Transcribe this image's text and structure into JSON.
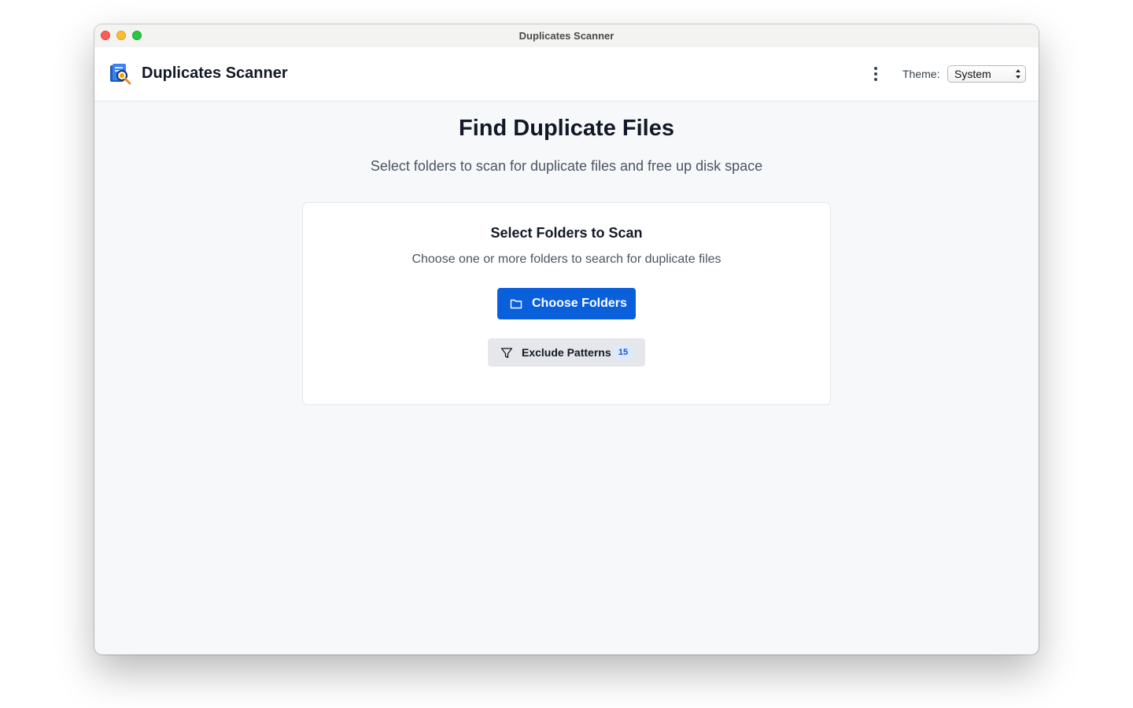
{
  "window": {
    "title": "Duplicates Scanner"
  },
  "header": {
    "app_name": "Duplicates Scanner",
    "logo_icon": "document-search-icon",
    "more_icon": "more-vertical-icon",
    "theme_label": "Theme:",
    "theme_value": "System"
  },
  "main": {
    "title": "Find Duplicate Files",
    "subtitle": "Select folders to scan for duplicate files and free up disk space"
  },
  "card": {
    "title": "Select Folders to Scan",
    "subtitle": "Choose one or more folders to search for duplicate files",
    "choose_button": {
      "label": "Choose Folders",
      "icon": "folder-icon"
    },
    "exclude_button": {
      "label": "Exclude Patterns",
      "icon": "filter-icon",
      "count": "15"
    }
  },
  "colors": {
    "primary": "#0a5fdb",
    "badge_bg": "#dbeafe",
    "badge_text": "#1d4ed8",
    "page_bg": "#f7f8fa"
  }
}
